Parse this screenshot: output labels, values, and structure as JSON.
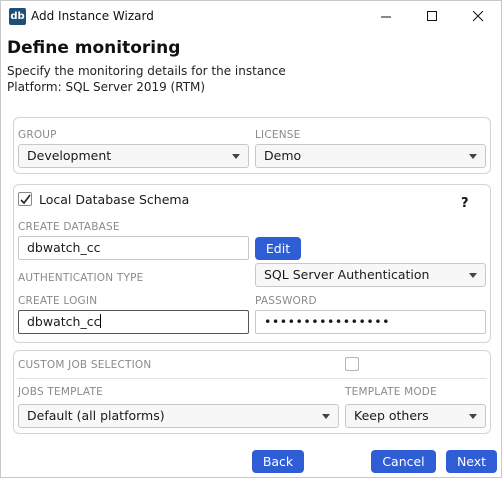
{
  "window": {
    "title": "Add Instance Wizard",
    "icon_label": "db"
  },
  "page": {
    "heading": "Define monitoring",
    "description": "Specify the monitoring details for the instance",
    "platform": "Platform: SQL Server 2019 (RTM)"
  },
  "group": {
    "label": "GROUP",
    "value": "Development"
  },
  "license": {
    "label": "LICENSE",
    "value": "Demo"
  },
  "schema": {
    "checkbox_label": "Local Database Schema",
    "checked": true,
    "help_label": "?"
  },
  "create_database": {
    "label": "CREATE DATABASE",
    "value": "dbwatch_cc",
    "edit_label": "Edit"
  },
  "auth": {
    "label": "AUTHENTICATION TYPE",
    "value": "SQL Server Authentication"
  },
  "create_login": {
    "label": "CREATE LOGIN",
    "value": "dbwatch_cc"
  },
  "password": {
    "label": "PASSWORD",
    "value": "••••••••••••••••"
  },
  "custom_job": {
    "label": "CUSTOM JOB SELECTION",
    "checked": false
  },
  "jobs_template": {
    "label": "JOBS TEMPLATE",
    "value": "Default (all platforms)"
  },
  "template_mode": {
    "label": "TEMPLATE MODE",
    "value": "Keep others"
  },
  "footer": {
    "back_label": "Back",
    "cancel_label": "Cancel",
    "next_label": "Next"
  },
  "colors": {
    "primary_button": "#2f5dd6",
    "app_icon": "#1f4e79"
  }
}
